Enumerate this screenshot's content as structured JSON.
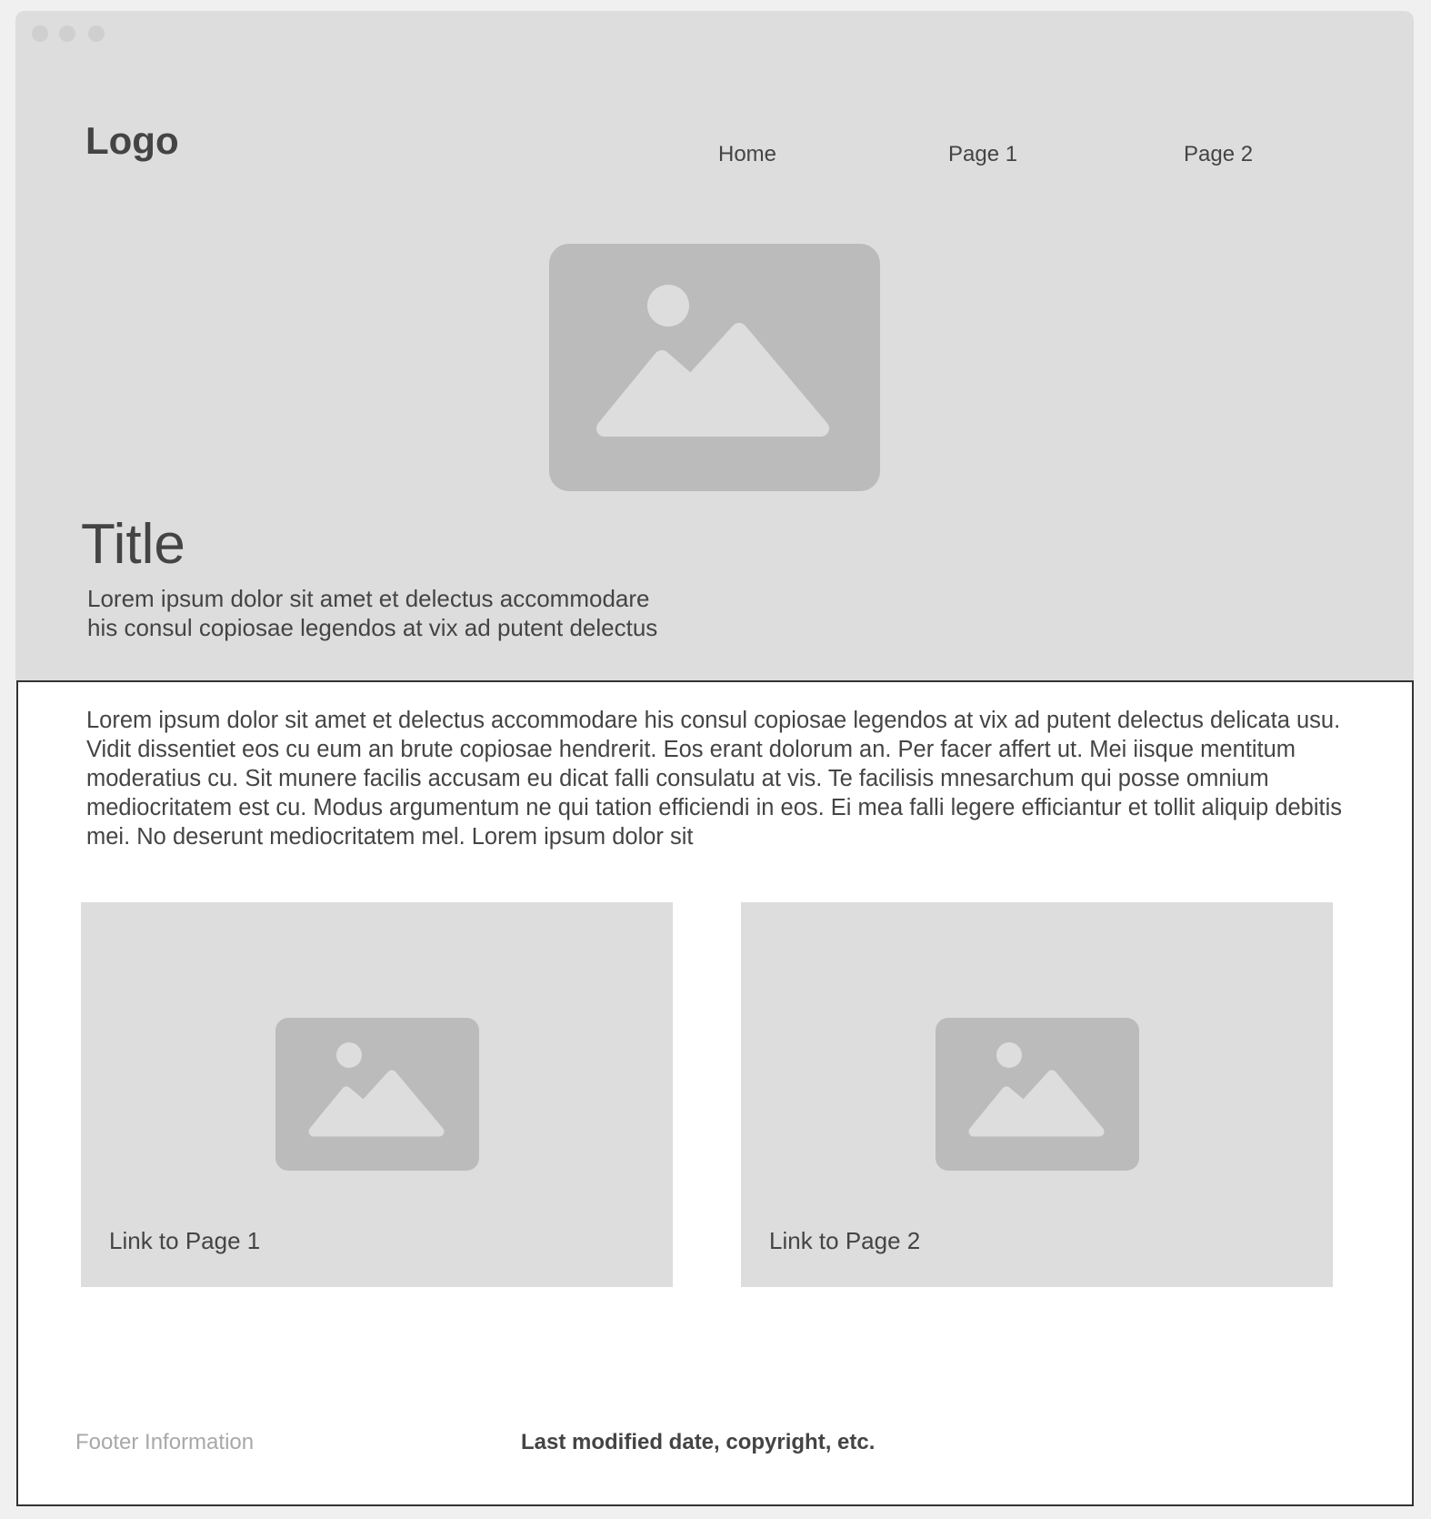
{
  "header": {
    "logo": "Logo",
    "nav": [
      {
        "label": "Home"
      },
      {
        "label": "Page 1"
      },
      {
        "label": "Page 2"
      }
    ]
  },
  "hero": {
    "image_icon": "image-placeholder-icon",
    "title": "Title",
    "subtitle_line1": "Lorem ipsum dolor sit amet et delectus accommodare",
    "subtitle_line2": "his consul copiosae legendos at vix ad putent delectus"
  },
  "main": {
    "body_text": "Lorem ipsum dolor sit amet et delectus accommodare his consul copiosae legendos at vix ad putent delectus delicata usu. Vidit dissentiet eos cu eum an brute copiosae hendrerit. Eos erant dolorum an. Per facer affert ut. Mei iisque mentitum moderatius cu. Sit munere facilis accusam eu dicat falli consulatu at vis. Te facilisis mnesarchum qui posse omnium mediocritatem est cu. Modus argumentum ne qui tation efficiendi in eos. Ei mea falli legere efficiantur et tollit aliquip debitis mei. No deserunt mediocritatem mel. Lorem ipsum dolor sit",
    "cards": [
      {
        "label": "Link to Page 1",
        "icon": "image-placeholder-icon"
      },
      {
        "label": "Link to Page 2",
        "icon": "image-placeholder-icon"
      }
    ]
  },
  "footer": {
    "info": "Footer Information",
    "meta": "Last modified date, copyright, etc."
  },
  "colors": {
    "background": "#f0f0f0",
    "panel": "#dddddd",
    "placeholder": "#bbbbbb",
    "text": "#444444",
    "muted": "#a8a8a8",
    "border": "#333333"
  }
}
